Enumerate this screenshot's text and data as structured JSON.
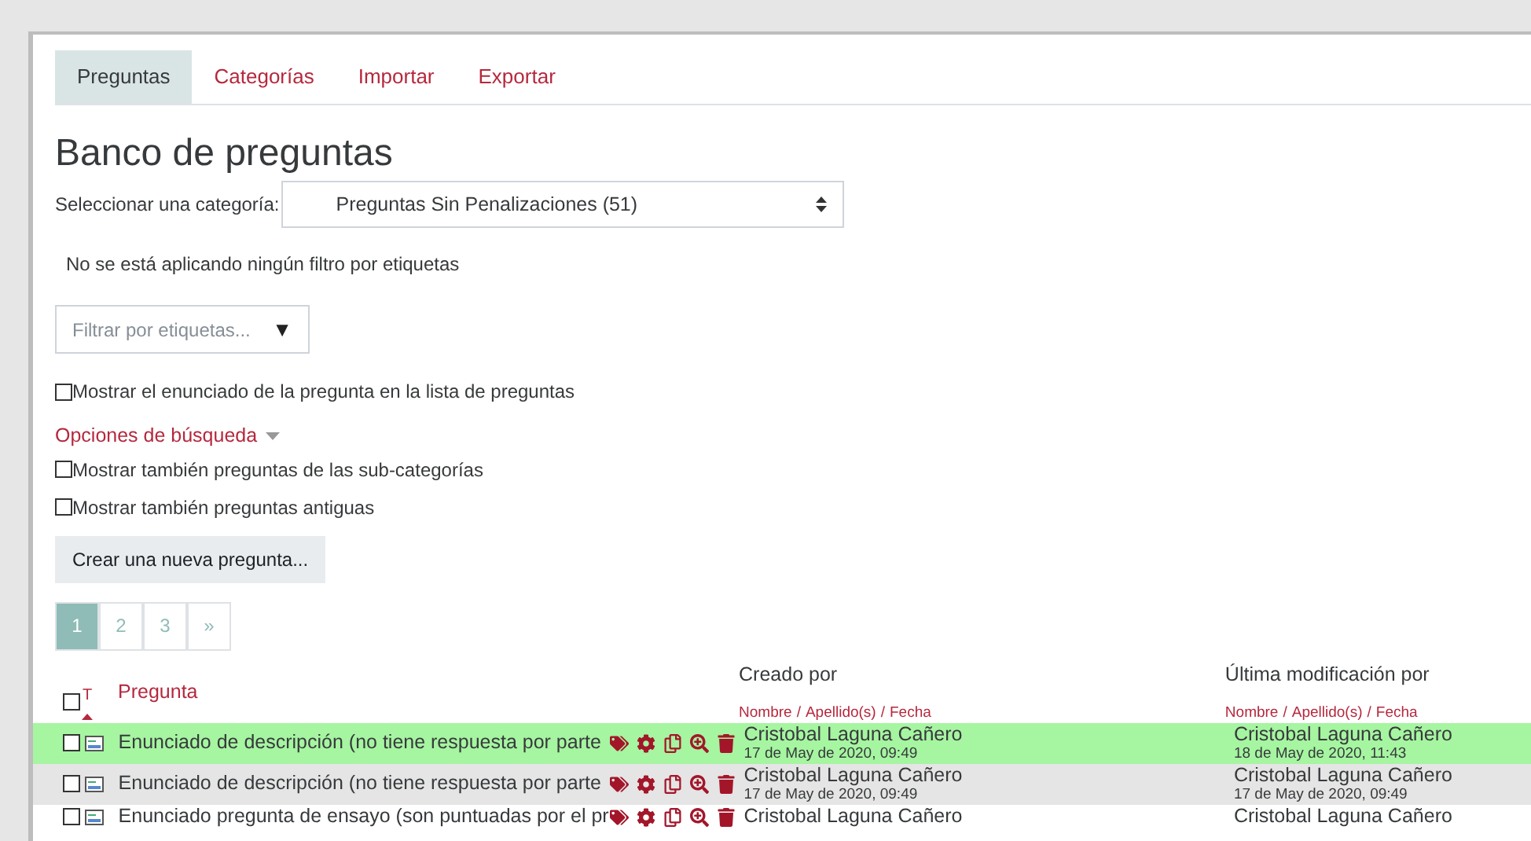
{
  "tabs": [
    {
      "label": "Preguntas",
      "selected": true
    },
    {
      "label": "Categorías",
      "selected": false
    },
    {
      "label": "Importar",
      "selected": false
    },
    {
      "label": "Exportar",
      "selected": false
    }
  ],
  "title": "Banco de preguntas",
  "category": {
    "label": "Seleccionar una categoría:",
    "value": "Preguntas Sin Penalizaciones (51)"
  },
  "filter_note": "No se está aplicando ningún filtro por etiquetas",
  "tag_filter": {
    "placeholder": "Filtrar por etiquetas...",
    "arrow": "▼"
  },
  "show_text_option": {
    "label": "Mostrar el enunciado de la pregunta en la lista de preguntas",
    "checked": false
  },
  "search_options": {
    "label": "Opciones de búsqueda",
    "options": [
      {
        "label": "Mostrar también preguntas de las sub-categorías",
        "checked": false
      },
      {
        "label": "Mostrar también preguntas antiguas",
        "checked": false
      }
    ]
  },
  "create_button": "Crear una nueva pregunta...",
  "pagination": [
    {
      "label": "1",
      "selected": true
    },
    {
      "label": "2",
      "selected": false
    },
    {
      "label": "3",
      "selected": false
    },
    {
      "label": "»",
      "selected": false
    }
  ],
  "table": {
    "select_all_checked": false,
    "type_sort": "T",
    "columns": [
      {
        "title": "Pregunta"
      },
      {
        "title": "Creado por",
        "sort_links": [
          "Nombre",
          "Apellido(s)",
          "Fecha"
        ],
        "separator": "/"
      },
      {
        "title": "Última modificación por",
        "sort_links": [
          "Nombre",
          "Apellido(s)",
          "Fecha"
        ],
        "separator": "/"
      }
    ],
    "rows": [
      {
        "highlighted": true,
        "checked": false,
        "question": "Enunciado de descripción (no tiene respuesta por parte",
        "created_by": "Cristobal Laguna Cañero",
        "created_date": "17 de May de 2020, 09:49",
        "modified_by": "Cristobal Laguna Cañero",
        "modified_date": "18 de May de 2020, 11:43"
      },
      {
        "highlighted": false,
        "checked": false,
        "question": "Enunciado de descripción (no tiene respuesta por parte",
        "created_by": "Cristobal Laguna Cañero",
        "created_date": "17 de May de 2020, 09:49",
        "modified_by": "Cristobal Laguna Cañero",
        "modified_date": "17 de May de 2020, 09:49"
      },
      {
        "highlighted": false,
        "checked": false,
        "question": "Enunciado pregunta de ensayo (son puntuadas por el pr",
        "created_by": "Cristobal Laguna Cañero",
        "modified_by": "Cristobal Laguna Cañero"
      }
    ]
  }
}
